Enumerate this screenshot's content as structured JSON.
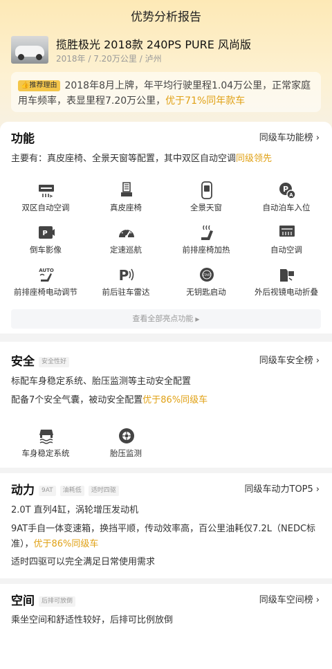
{
  "page_title": "优势分析报告",
  "car": {
    "name": "揽胜极光 2018款 240PS PURE 风尚版",
    "meta": "2018年 / 7.20万公里 / 泸州"
  },
  "reason": {
    "tag": "推荐理由",
    "text": "2018年8月上牌，年平均行驶里程1.04万公里，正常家庭用车频率，表显里程7.20万公里，",
    "highlight": "优于71%同年款车"
  },
  "function": {
    "title": "功能",
    "link": "同级车功能榜",
    "summary": "主要有：真皮座椅、全景天窗等配置，其中双区自动空调",
    "summary_highlight": "同级领先",
    "items": [
      {
        "label": "双区自动空调",
        "icon": "dual-zone-ac-icon"
      },
      {
        "label": "真皮座椅",
        "icon": "leather-seat-icon"
      },
      {
        "label": "全景天窗",
        "icon": "panoramic-sunroof-icon"
      },
      {
        "label": "自动泊车入位",
        "icon": "auto-parking-icon"
      },
      {
        "label": "倒车影像",
        "icon": "reverse-camera-icon"
      },
      {
        "label": "定速巡航",
        "icon": "cruise-control-icon"
      },
      {
        "label": "前排座椅加热",
        "icon": "seat-heating-icon"
      },
      {
        "label": "自动空调",
        "icon": "auto-ac-icon"
      },
      {
        "label": "前排座椅电动调节",
        "icon": "power-seat-icon"
      },
      {
        "label": "前后驻车雷达",
        "icon": "parking-radar-icon"
      },
      {
        "label": "无钥匙启动",
        "icon": "keyless-start-icon"
      },
      {
        "label": "外后视镜电动折叠",
        "icon": "mirror-fold-icon"
      }
    ],
    "more": "查看全部亮点功能"
  },
  "safety": {
    "title": "安全",
    "chip": "安全性好",
    "link": "同级车安全榜",
    "line1": "标配车身稳定系统、胎压监测等主动安全配置",
    "line2": "配备7个安全气囊，被动安全配置",
    "line2_highlight": "优于86%同级车",
    "items": [
      {
        "label": "车身稳定系统",
        "icon": "stability-control-icon"
      },
      {
        "label": "胎压监测",
        "icon": "tire-pressure-icon"
      }
    ]
  },
  "power": {
    "title": "动力",
    "chips": [
      "9AT",
      "油耗低",
      "适时四驱"
    ],
    "link": "同级车动力TOP5",
    "line1": "2.0T 直列4缸，涡轮增压发动机",
    "line2": "9AT手自一体变速箱，换挡平顺，传动效率高，百公里油耗仅7.2L（NEDC标准），",
    "line2_highlight": "优于86%同级车",
    "line3": "适时四驱可以完全满足日常使用需求"
  },
  "space": {
    "title": "空间",
    "chip": "后排可放倒",
    "link": "同级车空间榜",
    "line1": "乘坐空间和舒适性较好，后排可比例放倒"
  },
  "colors": {
    "accent": "#e0a115",
    "tag": "#f4c64a",
    "icon": "#444444"
  }
}
